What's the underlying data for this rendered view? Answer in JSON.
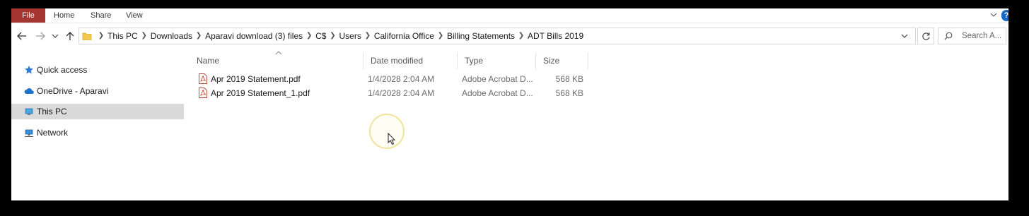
{
  "ribbon": {
    "tabs": [
      {
        "label": "File",
        "active": true
      },
      {
        "label": "Home"
      },
      {
        "label": "Share"
      },
      {
        "label": "View"
      }
    ],
    "help_label": "?"
  },
  "address": {
    "breadcrumbs": [
      "This PC",
      "Downloads",
      "Aparavi download (3) files",
      "C$",
      "Users",
      "California Office",
      "Billing Statements",
      "ADT Bills 2019"
    ]
  },
  "search": {
    "placeholder": "Search A..."
  },
  "nav_pane": {
    "items": [
      {
        "label": "Quick access",
        "icon": "star-icon"
      },
      {
        "label": "OneDrive - Aparavi",
        "icon": "cloud-icon"
      },
      {
        "label": "This PC",
        "icon": "computer-icon",
        "selected": true
      },
      {
        "label": "Network",
        "icon": "network-icon"
      }
    ]
  },
  "file_list": {
    "columns": [
      "Name",
      "Date modified",
      "Type",
      "Size"
    ],
    "sort_column": "Name",
    "rows": [
      {
        "name": "Apr 2019 Statement.pdf",
        "date": "1/4/2028 2:04 AM",
        "type": "Adobe Acrobat D...",
        "size": "568 KB"
      },
      {
        "name": "Apr 2019 Statement_1.pdf",
        "date": "1/4/2028 2:04 AM",
        "type": "Adobe Acrobat D...",
        "size": "568 KB"
      }
    ]
  },
  "colors": {
    "file_tab": "#a4342f",
    "selected_nav": "#d9d9d9",
    "accent_blue": "#1467c3",
    "cursor_highlight": "#efe39a"
  }
}
